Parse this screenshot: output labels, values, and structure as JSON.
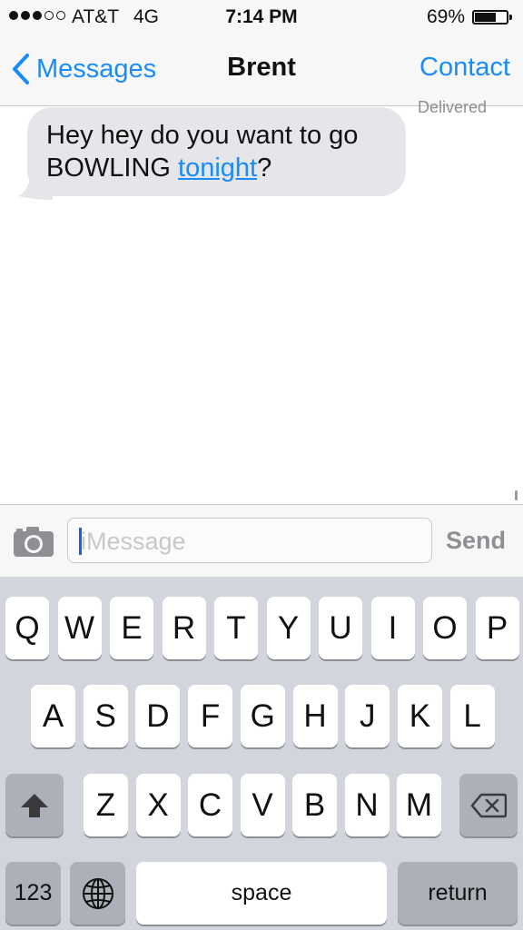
{
  "status": {
    "carrier": "AT&T",
    "network": "4G",
    "time": "7:14 PM",
    "battery_percent": "69%",
    "battery_level": 0.69,
    "signal_filled": 3,
    "signal_total": 5
  },
  "nav": {
    "back_label": "Messages",
    "title": "Brent",
    "contact_label": "Contact"
  },
  "conversation": {
    "delivered_label": "Delivered",
    "messages": [
      {
        "text_before": "Hey hey do you want to go BOWLING ",
        "link_text": "tonight",
        "text_after": "?"
      }
    ]
  },
  "composer": {
    "placeholder": "iMessage",
    "send_label": "Send"
  },
  "keyboard": {
    "row1": [
      "Q",
      "W",
      "E",
      "R",
      "T",
      "Y",
      "U",
      "I",
      "O",
      "P"
    ],
    "row2": [
      "A",
      "S",
      "D",
      "F",
      "G",
      "H",
      "J",
      "K",
      "L"
    ],
    "row3": [
      "Z",
      "X",
      "C",
      "V",
      "B",
      "N",
      "M"
    ],
    "numbers_label": "123",
    "space_label": "space",
    "return_label": "return"
  },
  "colors": {
    "accent": "#1a8cf7",
    "bubble_incoming": "#e5e5ea",
    "keyboard_bg": "#d2d5db"
  }
}
